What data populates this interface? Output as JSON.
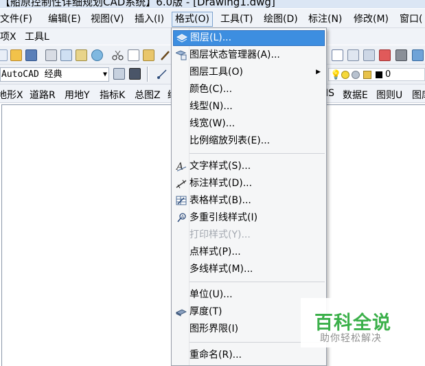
{
  "title": {
    "text": "【船原控制性详细规划CAD系统】6.0版 - [Drawing1.dwg]"
  },
  "menubar": {
    "items": [
      "文件(F)",
      "编辑(E)",
      "视图(V)",
      "插入(I)",
      "格式(O)",
      "工具(T)",
      "绘图(D)",
      "标注(N)",
      "修改(M)",
      "窗口("
    ]
  },
  "menubar2": {
    "items": [
      "项X",
      "工具L"
    ]
  },
  "toolbar2": {
    "workspace": "AutoCAD 经典",
    "layer_value": "0"
  },
  "cmdbar": {
    "left": [
      "地形X",
      "道路R",
      "用地Y",
      "指标K",
      "总图Z",
      "绘"
    ],
    "right": [
      "IS",
      "数据E",
      "图则U",
      "图库"
    ]
  },
  "format_menu": {
    "items": [
      {
        "label": "图层(L)...",
        "icon": "layers-icon",
        "highlighted": true
      },
      {
        "label": "图层状态管理器(A)...",
        "icon": "layer-state-icon"
      },
      {
        "label": "图层工具(O)",
        "submenu": true
      },
      {
        "label": "颜色(C)..."
      },
      {
        "label": "线型(N)..."
      },
      {
        "label": "线宽(W)..."
      },
      {
        "label": "比例缩放列表(E)..."
      },
      {
        "label": "文字样式(S)...",
        "icon": "text-style-icon"
      },
      {
        "label": "标注样式(D)...",
        "icon": "dimension-style-icon"
      },
      {
        "label": "表格样式(B)...",
        "icon": "table-style-icon"
      },
      {
        "label": "多重引线样式(I)",
        "icon": "multileader-style-icon"
      },
      {
        "label": "打印样式(Y)...",
        "disabled": true
      },
      {
        "label": "点样式(P)..."
      },
      {
        "label": "多线样式(M)..."
      },
      {
        "label": "单位(U)..."
      },
      {
        "label": "厚度(T)",
        "icon": "thickness-icon"
      },
      {
        "label": "图形界限(I)"
      },
      {
        "label": "重命名(R)..."
      }
    ]
  },
  "watermark": {
    "title": "百科全说",
    "subtitle": "助你轻松解决"
  },
  "colors": {
    "highlight": "#3d8ee0",
    "watermark_green": "#3bb04a"
  }
}
